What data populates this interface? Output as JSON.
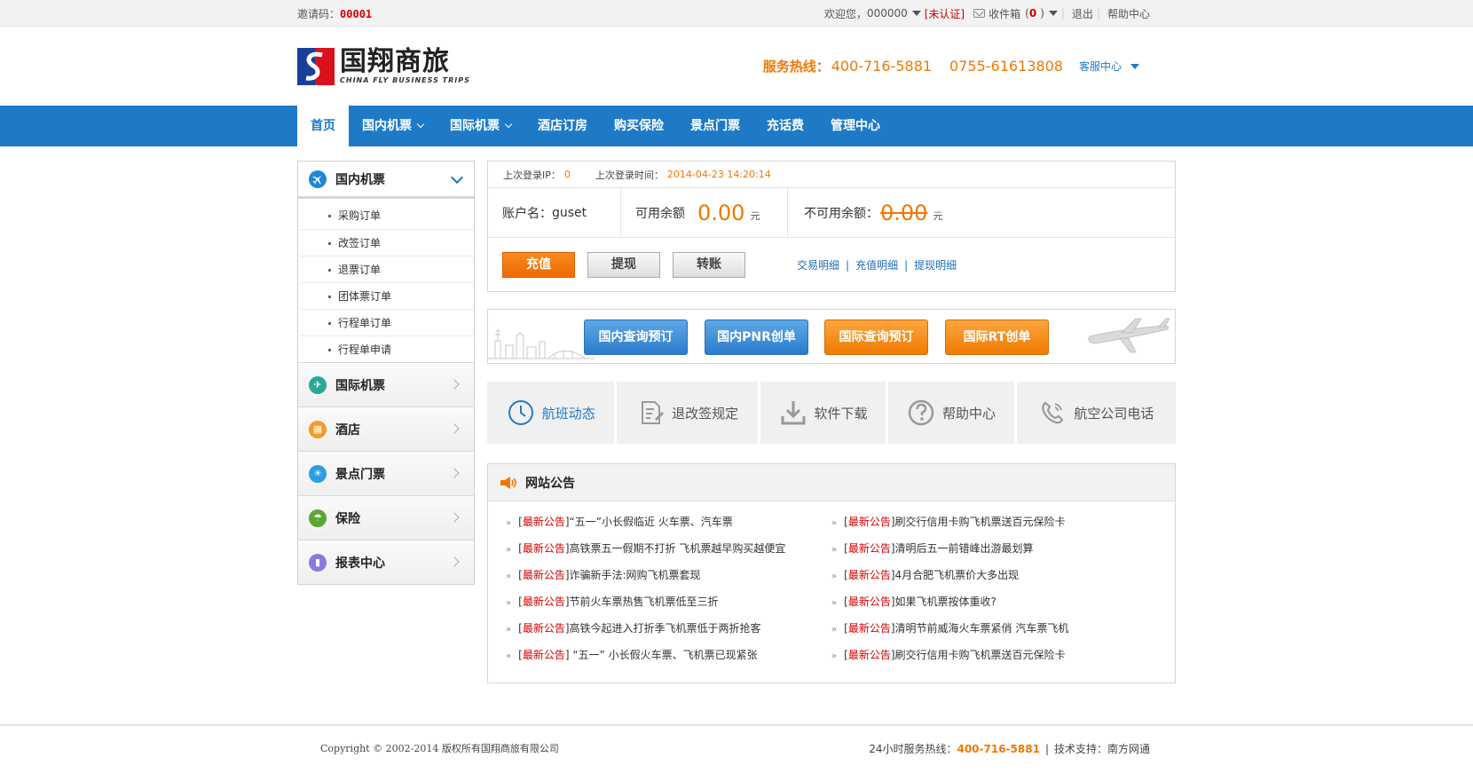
{
  "topbar": {
    "invite_label": "邀请码：",
    "invite_code": "00001",
    "welcome": "欢迎您，",
    "username": "000000",
    "unverified": "[未认证]",
    "inbox_label": "收件箱",
    "inbox_open": "(",
    "inbox_count": "0",
    "inbox_close": ")",
    "logout": "退出",
    "help": "帮助中心"
  },
  "header": {
    "logo_cn": "国翔商旅",
    "logo_en": "CHINA FLY BUSINESS TRIPS",
    "hotline_label": "服务热线：",
    "hotline_1": "400-716-5881",
    "hotline_2": "0755-61613808",
    "service_center": "客服中心"
  },
  "nav": {
    "items": [
      {
        "label": "首页",
        "active": true,
        "dropdown": false
      },
      {
        "label": "国内机票",
        "active": false,
        "dropdown": true
      },
      {
        "label": "国际机票",
        "active": false,
        "dropdown": true
      },
      {
        "label": "酒店订房",
        "active": false,
        "dropdown": false
      },
      {
        "label": "购买保险",
        "active": false,
        "dropdown": false
      },
      {
        "label": "景点门票",
        "active": false,
        "dropdown": false
      },
      {
        "label": "充话费",
        "active": false,
        "dropdown": false
      },
      {
        "label": "管理中心",
        "active": false,
        "dropdown": false
      }
    ]
  },
  "sidebar": {
    "domestic_title": "国内机票",
    "sub_items": [
      "采购订单",
      "改签订单",
      "退票订单",
      "团体票订单",
      "行程单订单",
      "行程单申请"
    ],
    "sections": [
      {
        "label": "国际机票",
        "icon": "globe-plane-icon",
        "color": "#2aa89a"
      },
      {
        "label": "酒店",
        "icon": "hotel-icon",
        "color": "#f39a2a"
      },
      {
        "label": "景点门票",
        "icon": "scenery-icon",
        "color": "#2a9ee0"
      },
      {
        "label": "保险",
        "icon": "umbrella-icon",
        "color": "#5aa832"
      },
      {
        "label": "报表中心",
        "icon": "report-icon",
        "color": "#8a7adf"
      }
    ]
  },
  "account": {
    "last_ip_label": "上次登录IP：",
    "last_ip": "0",
    "last_time_label": "上次登录时间：",
    "last_time": "2014-04-23 14:20:14",
    "account_label": "账户名：",
    "account_name": "guset",
    "available_label": "可用余额",
    "available_value": "0.00",
    "unavailable_label": "不可用余额：",
    "unavailable_value": "0.00",
    "yuan": "元",
    "btn_recharge": "充值",
    "btn_withdraw": "提现",
    "btn_transfer": "转账",
    "link_trade": "交易明细",
    "link_recharge": "充值明细",
    "link_withdraw": "提现明细",
    "link_sep": "|"
  },
  "quick": {
    "btn1": "国内查询预订",
    "btn2": "国内PNR创单",
    "btn3": "国际查询预订",
    "btn4": "国际RT创单"
  },
  "tools": {
    "flight_status": "航班动态",
    "refund_rules": "退改签规定",
    "software": "软件下载",
    "help": "帮助中心",
    "airline_phone": "航空公司电话"
  },
  "notice": {
    "title": "网站公告",
    "tag": "最新公告",
    "left": [
      "“五一”小长假临近 火车票、汽车票",
      "高铁票五一假期不打折 飞机票越早购买越便宜",
      "诈骗新手法:网购飞机票套现",
      "节前火车票热售飞机票低至三折",
      "高铁今起进入打折季飞机票低于两折抢客",
      " “五一” 小长假火车票、飞机票已现紧张"
    ],
    "right": [
      "刷交行信用卡购飞机票送百元保险卡",
      "清明后五一前错峰出游最划算",
      "4月合肥飞机票价大多出现",
      "如果飞机票按体重收?",
      "清明节前威海火车票紧俏 汽车票飞机",
      "刷交行信用卡购飞机票送百元保险卡"
    ]
  },
  "footer": {
    "copyright_prefix": "Copyright © 2002-2014",
    "copyright_suffix": " 版权所有国翔商旅有限公司",
    "hotline_label": "24小时服务热线：",
    "hotline": "400-716-5881",
    "sep": "|",
    "tech": "技术支持：南方网通"
  }
}
